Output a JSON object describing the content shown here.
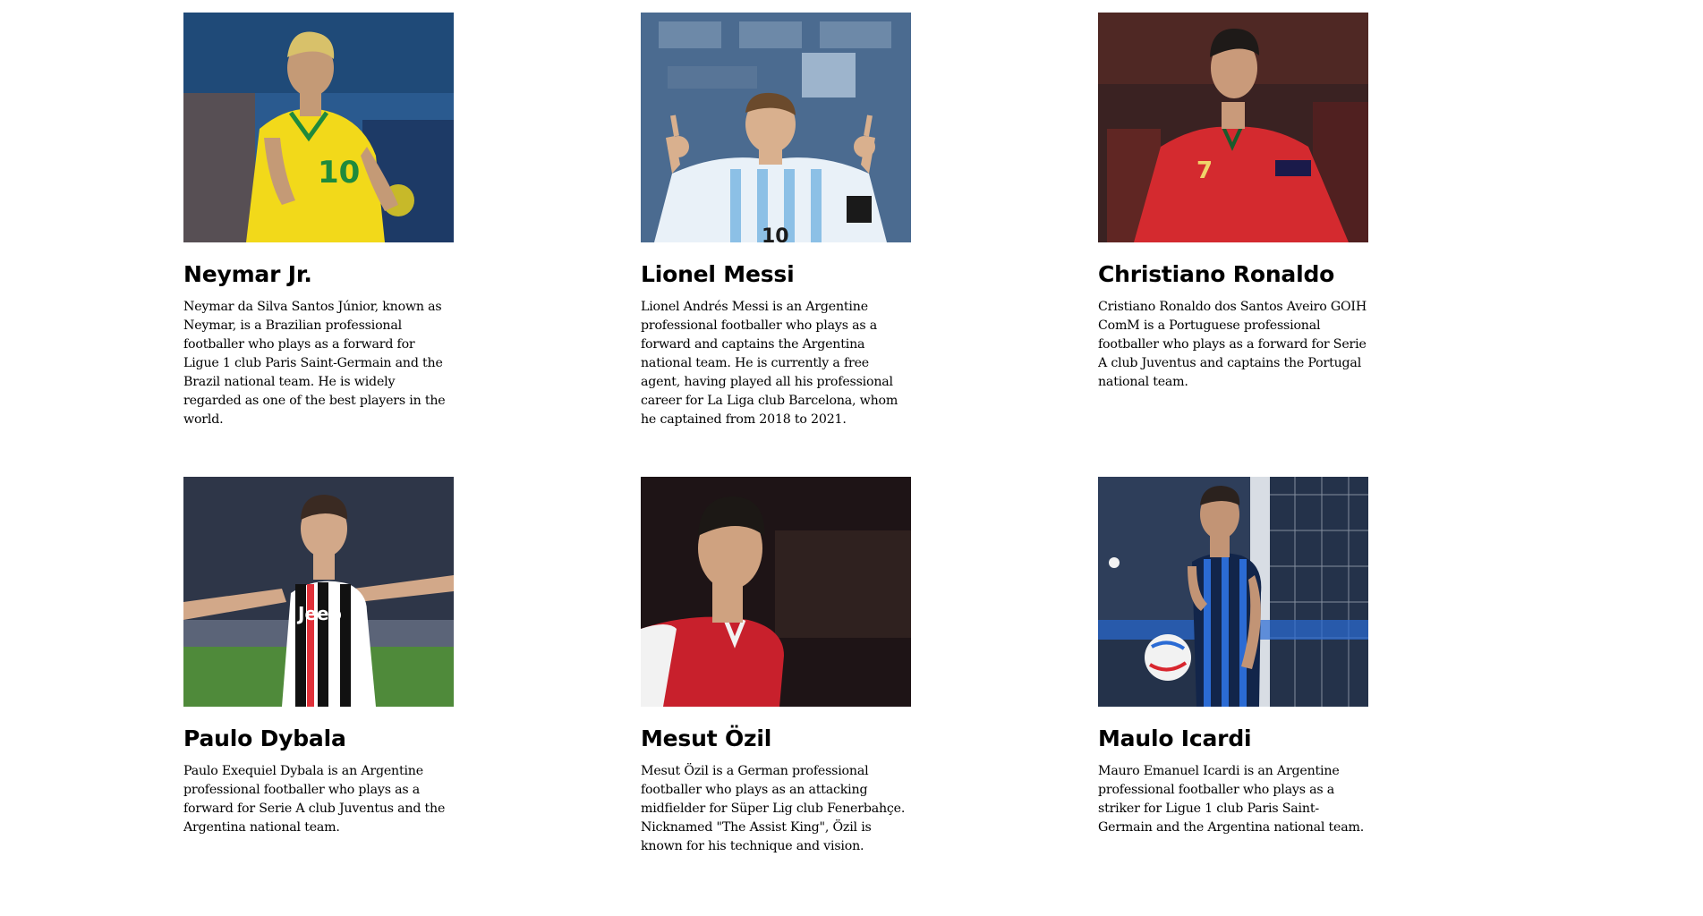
{
  "players": [
    {
      "name": "Neymar Jr.",
      "photo_alt": "neymar-photo",
      "bio": "Neymar da Silva Santos Júnior, known as Neymar, is a Brazilian professional footballer who plays as a forward for Ligue 1 club Paris Saint-Germain and the Brazil national team. He is widely regarded as one of the best players in the world.",
      "jersey_number": "10",
      "colors": {
        "background": "#2a5a8f",
        "shirt": "#f2d91a",
        "trim": "#1f8a3c",
        "skin": "#c49a76",
        "hair": "#d8c16a"
      }
    },
    {
      "name": "Lionel Messi",
      "photo_alt": "messi-photo",
      "bio": "Lionel Andrés Messi is an Argentine professional footballer who plays as a forward and captains the Argentina national team. He is currently a free agent, having played all his professional career for La Liga club Barcelona, whom he captained from 2018 to 2021.",
      "jersey_number": "10",
      "colors": {
        "background": "#4b6b90",
        "shirt": "#e9f1f8",
        "trim": "#8cc0e6",
        "skin": "#d9b08e",
        "hair": "#6b4a2c"
      }
    },
    {
      "name": "Christiano Ronaldo",
      "photo_alt": "ronaldo-photo",
      "bio": "Cristiano Ronaldo dos Santos Aveiro GOIH ComM is a Portuguese professional footballer who plays as a forward for Serie A club Juventus and captains the Portugal national team.",
      "jersey_number": "7",
      "colors": {
        "background": "#3a2222",
        "shirt": "#d42a2f",
        "trim": "#1a5a2c",
        "skin": "#c99a7a",
        "hair": "#1e1a18"
      }
    },
    {
      "name": "Paulo Dybala",
      "photo_alt": "dybala-photo",
      "bio": "Paulo Exequiel Dybala is an Argentine professional footballer who plays as a forward for Serie A club Juventus and the Argentina national team.",
      "jersey_number": "Jeep",
      "colors": {
        "background": "#3b4456",
        "shirt": "#ffffff",
        "trim": "#111111",
        "skin": "#d2a889",
        "hair": "#3a2a22",
        "grass": "#4f8a3a"
      }
    },
    {
      "name": "Mesut Özil",
      "photo_alt": "ozil-photo",
      "bio": "Mesut Özil is a German professional footballer who plays as an attacking midfielder for Süper Lig club Fenerbahçe. Nicknamed \"The Assist King\", Özil is known for his technique and vision.",
      "jersey_number": "",
      "colors": {
        "background": "#1e1416",
        "shirt": "#c8202c",
        "trim": "#f2f2f2",
        "skin": "#cfa280",
        "hair": "#1c1815"
      }
    },
    {
      "name": "Maulo Icardi",
      "photo_alt": "icardi-photo",
      "bio": "Mauro Emanuel Icardi is an Argentine professional footballer who plays as a striker for Ligue 1 club Paris Saint-Germain and the Argentina national team.",
      "jersey_number": "",
      "colors": {
        "background": "#24324a",
        "shirt": "#12254a",
        "trim": "#2b6bd4",
        "skin": "#c29475",
        "hair": "#2b221e"
      }
    }
  ]
}
